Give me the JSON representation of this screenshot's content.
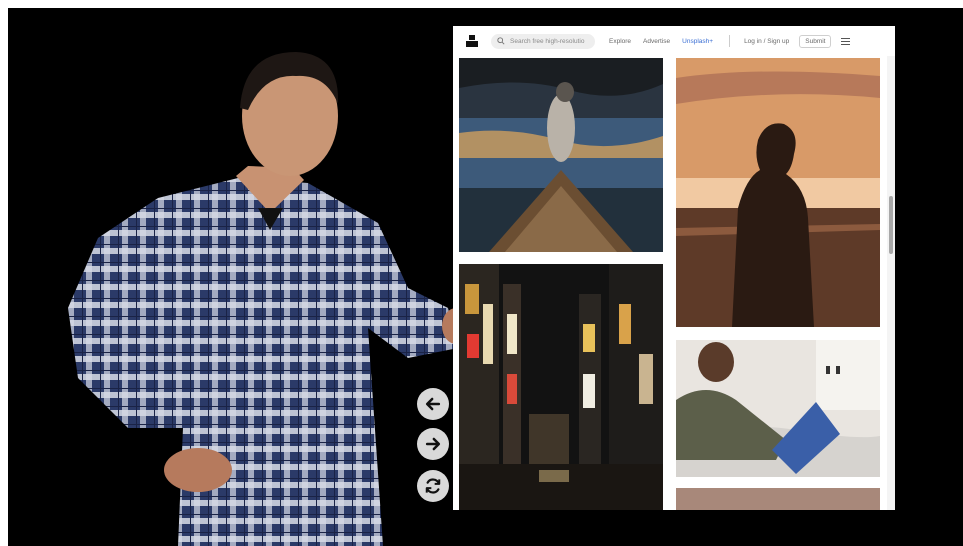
{
  "browser": {
    "search": {
      "placeholder": "Search free high-resolutio"
    },
    "nav": {
      "explore": "Explore",
      "advertise": "Advertise",
      "unsplash_plus": "Unsplash+"
    },
    "auth": "Log in  /  Sign up",
    "submit_label": "Submit",
    "colors": {
      "accent": "#3b6fd4"
    }
  },
  "photos": [
    {
      "name": "husky-in-boat",
      "colors": [
        "#1c2a38",
        "#3d5a7a",
        "#e4a85a"
      ]
    },
    {
      "name": "silhouette-sunset",
      "colors": [
        "#d89a68",
        "#f1c9a2",
        "#3a2419"
      ]
    },
    {
      "name": "night-city-street",
      "colors": [
        "#121212",
        "#c8963c",
        "#e23a32"
      ]
    },
    {
      "name": "woman-with-tablet",
      "colors": [
        "#e9e5e0",
        "#5c5f4a",
        "#3a5fa8"
      ]
    }
  ],
  "controls": {
    "back_icon": "arrow-left-icon",
    "forward_icon": "arrow-right-icon",
    "reload_icon": "refresh-icon"
  }
}
